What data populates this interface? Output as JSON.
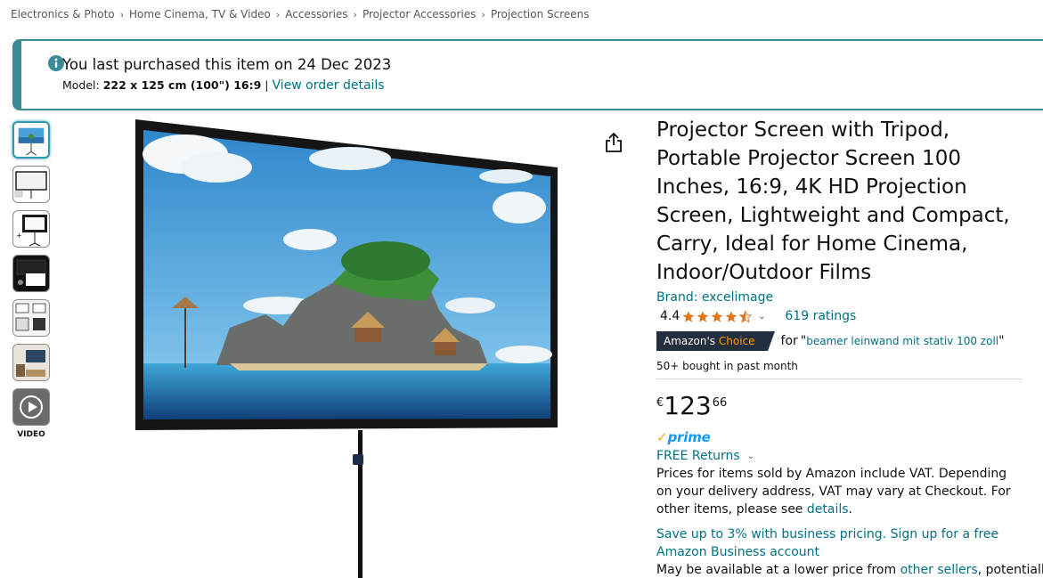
{
  "breadcrumb": [
    "Electronics & Photo",
    "Home Cinema, TV & Video",
    "Accessories",
    "Projector Accessories",
    "Projection Screens"
  ],
  "breadcrumb_separator": "›",
  "purchase": {
    "title": "You last purchased this item on 24 Dec 2023",
    "model_label": "Model:",
    "model_value": "222 x 125 cm (100\") 16:9",
    "separator": "|",
    "link": "View order details"
  },
  "thumbnails": {
    "video_label": "VIDEO"
  },
  "product": {
    "title": "Projector Screen with Tripod, Portable Projector Screen 100 Inches, 16:9, 4K HD Projection Screen, Lightweight and Compact, Carry, Ideal for Home Cinema, Indoor/Outdoor Films",
    "brand": "Brand: excelimage",
    "rating": "4.4",
    "rating_stars": 4.4,
    "ratings_count": "619 ratings",
    "choice_badge_prefix": "Amazon's",
    "choice_badge_accent": "Choice",
    "choice_for": "for",
    "choice_quote_open": "\"",
    "choice_term": "beamer leinwand mit stativ 100 zoll",
    "choice_quote_close": "\"",
    "bought": "50+ bought in past month",
    "price": {
      "symbol": "€",
      "whole": "123",
      "fraction": "66"
    },
    "prime_check": "✓",
    "prime": "prime",
    "returns": "FREE Returns",
    "vat_text_1": "Prices for items sold by Amazon include VAT. Depending on your delivery address, VAT may vary at Checkout. For other items, please see ",
    "vat_link": "details",
    "vat_end": ".",
    "business": "Save up to 3% with business pricing. Sign up for a free Amazon Business account",
    "lower_1": "May be available at a lower price from ",
    "lower_link": "other sellers",
    "lower_2": ", potentially"
  },
  "colors": {
    "link": "#007185",
    "star": "#de7921",
    "banner_border": "#3c8b99",
    "choice_bg": "#232f3e",
    "choice_accent": "#ff9900",
    "prime_blue": "#1399ff"
  },
  "icons": [
    "info-icon",
    "share-icon",
    "star-icon",
    "chevron-down-icon",
    "play-icon"
  ]
}
